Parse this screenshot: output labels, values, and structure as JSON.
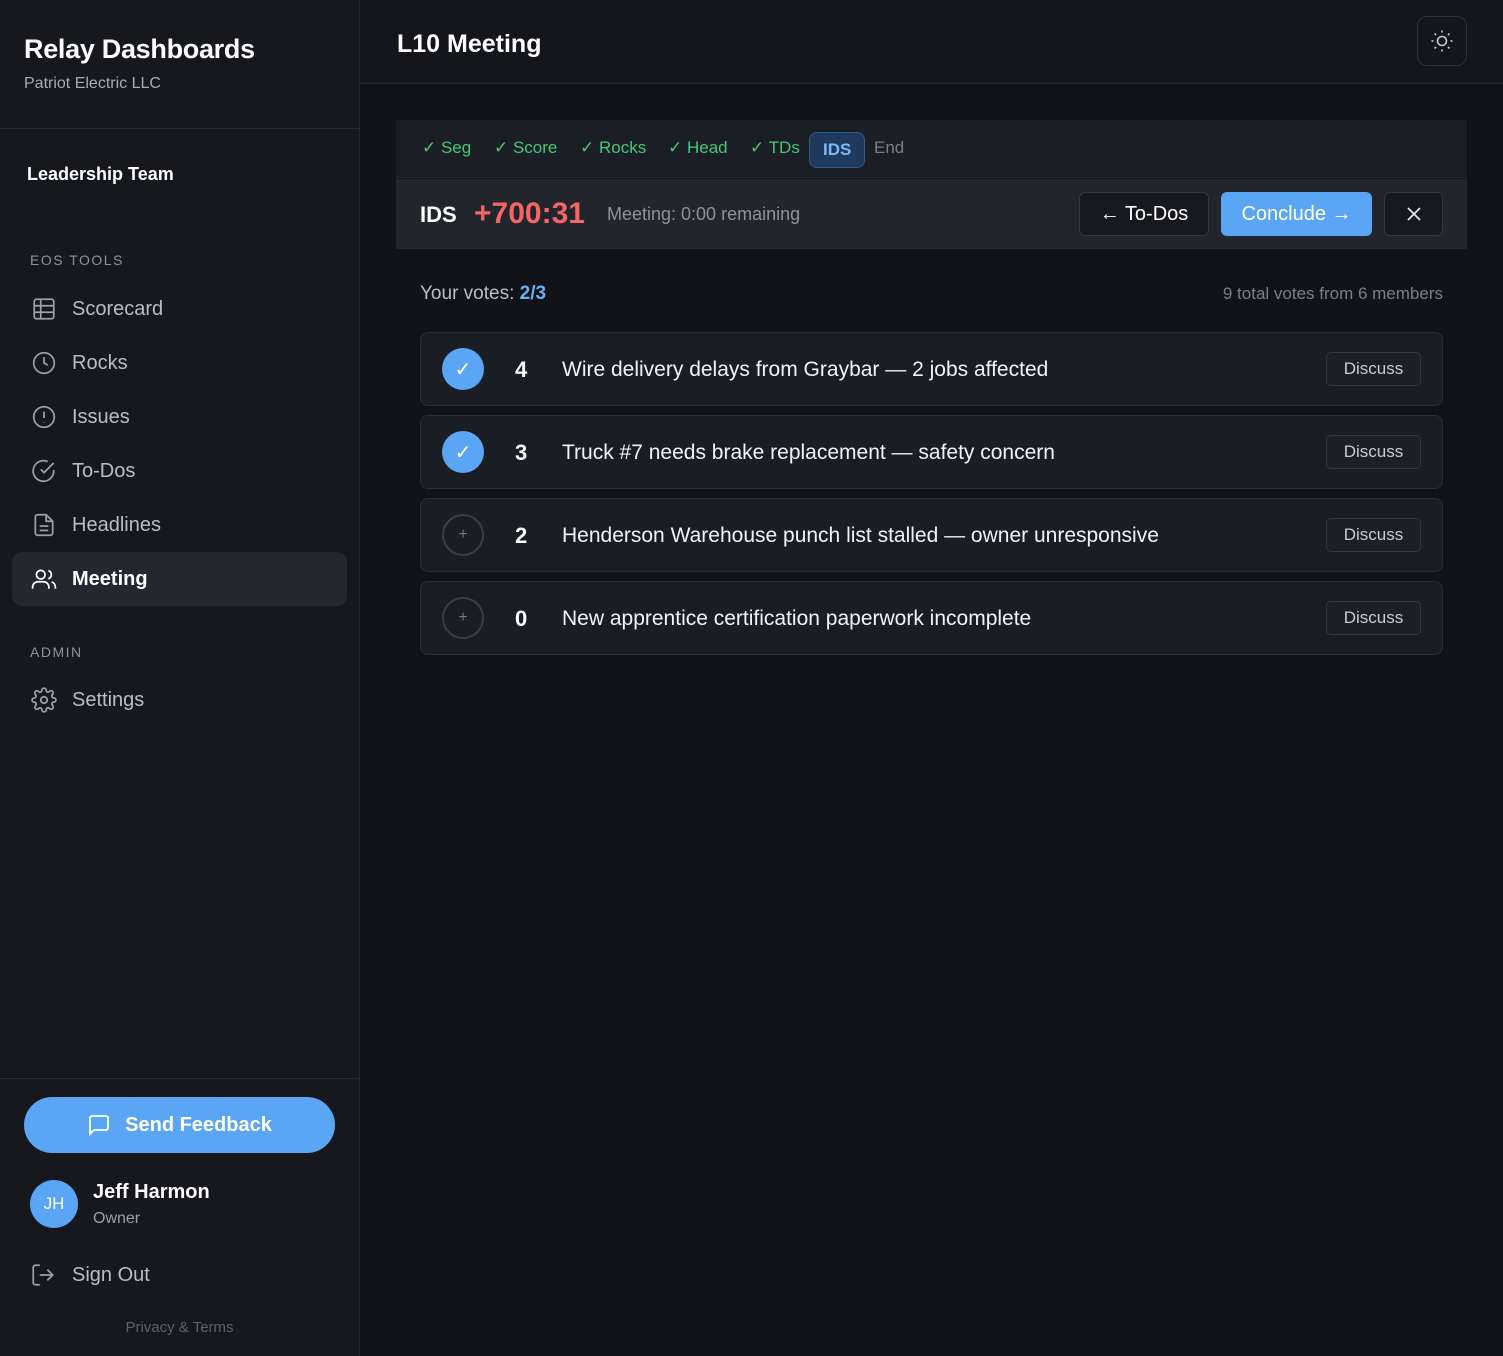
{
  "brand": {
    "title": "Relay Dashboards",
    "subtitle": "Patriot Electric LLC"
  },
  "team": {
    "name": "Leadership Team"
  },
  "sidebar": {
    "eos_label": "EOS TOOLS",
    "eos_items": [
      {
        "label": "Scorecard",
        "icon": "table-icon"
      },
      {
        "label": "Rocks",
        "icon": "clock-icon"
      },
      {
        "label": "Issues",
        "icon": "alert-circle-icon"
      },
      {
        "label": "To-Dos",
        "icon": "check-circle-icon"
      },
      {
        "label": "Headlines",
        "icon": "document-icon"
      },
      {
        "label": "Meeting",
        "icon": "users-icon",
        "active": true
      }
    ],
    "admin_label": "ADMIN",
    "admin_items": [
      {
        "label": "Settings",
        "icon": "gear-icon"
      }
    ],
    "feedback_label": "Send Feedback",
    "user": {
      "initials": "JH",
      "name": "Jeff Harmon",
      "role": "Owner"
    },
    "signout_label": "Sign Out",
    "privacy_label": "Privacy & Terms"
  },
  "header": {
    "title": "L10 Meeting",
    "theme_icon": "sun-icon"
  },
  "steps": [
    {
      "label": "✓ Seg",
      "state": "done"
    },
    {
      "label": "✓ Score",
      "state": "done"
    },
    {
      "label": "✓ Rocks",
      "state": "done"
    },
    {
      "label": "✓ Head",
      "state": "done"
    },
    {
      "label": "✓ TDs",
      "state": "done"
    },
    {
      "label": "IDS",
      "state": "current"
    },
    {
      "label": "End",
      "state": "pending"
    }
  ],
  "phase": {
    "name": "IDS",
    "timer": "+700:31",
    "remaining": "Meeting: 0:00 remaining",
    "back_label": "← To-Dos",
    "conclude_label": "Conclude →",
    "close_icon": "close-icon"
  },
  "votes": {
    "prefix": "Your votes: ",
    "value": "2/3",
    "total": "9 total votes from 6 members"
  },
  "issues": [
    {
      "count": "4",
      "title": "Wire delivery delays from Graybar — 2 jobs affected",
      "voted": true,
      "mark": "✓",
      "action": "Discuss"
    },
    {
      "count": "3",
      "title": "Truck #7 needs brake replacement — safety concern",
      "voted": true,
      "mark": "✓",
      "action": "Discuss"
    },
    {
      "count": "2",
      "title": "Henderson Warehouse punch list stalled — owner unresponsive",
      "voted": false,
      "mark": "+",
      "action": "Discuss"
    },
    {
      "count": "0",
      "title": "New apprentice certification paperwork incomplete",
      "voted": false,
      "mark": "+",
      "action": "Discuss"
    }
  ],
  "colors": {
    "accent": "#5aa6f5",
    "done": "#43c978",
    "timer": "#f26666",
    "background": "#111318"
  }
}
